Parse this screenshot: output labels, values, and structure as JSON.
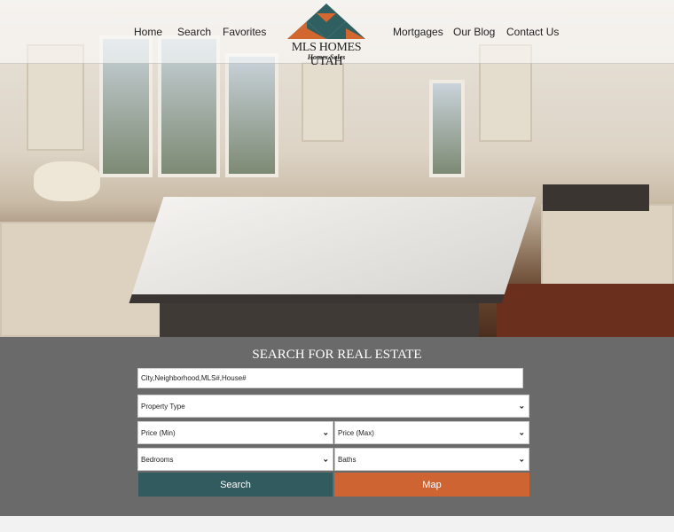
{
  "nav": {
    "left": [
      "Home",
      "Search",
      "Favorites"
    ],
    "right": [
      "Mortgages",
      "Our Blog",
      "Contact Us"
    ]
  },
  "logo": {
    "name": "MLS HOMES UTAH",
    "tagline": "Homes Sales",
    "colors": {
      "teal": "#2f5f61",
      "orange": "#d2672f"
    }
  },
  "search": {
    "title": "SEARCH FOR REAL ESTATE",
    "location_placeholder": "City,Neighborhood,MLS#,House#",
    "property_type": "Property Type",
    "price_min": "Price (Min)",
    "price_max": "Price (Max)",
    "bedrooms": "Bedrooms",
    "baths": "Baths",
    "search_label": "Search",
    "map_label": "Map",
    "search_color": "#315b5f",
    "map_color": "#cf6433"
  }
}
